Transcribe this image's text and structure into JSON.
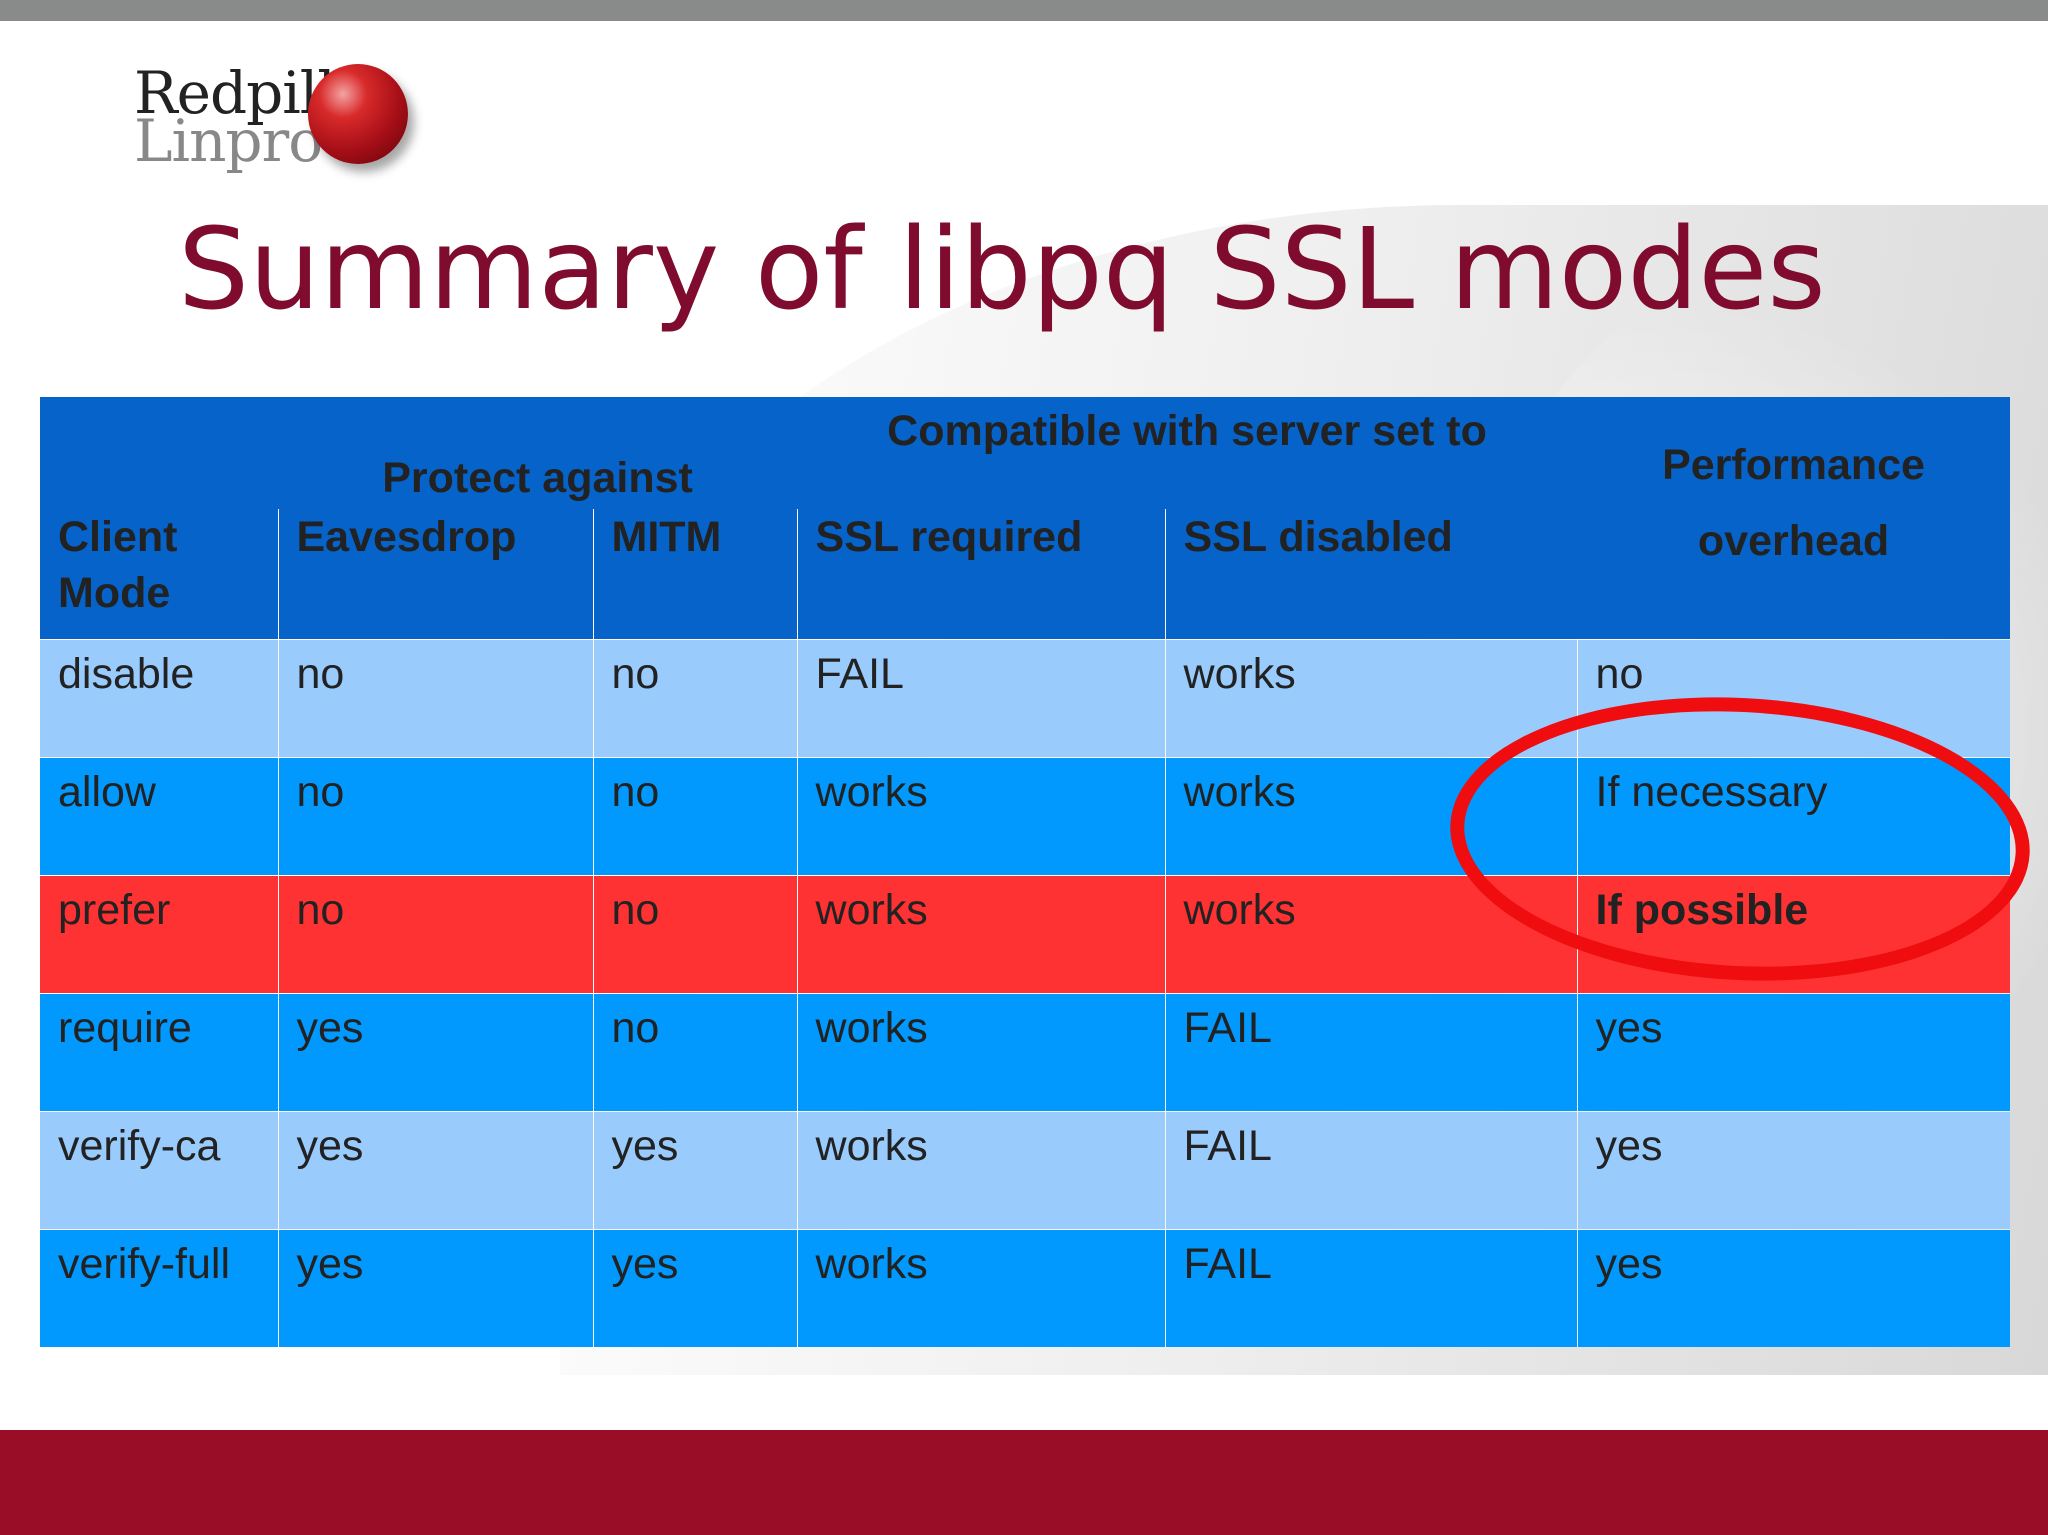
{
  "slide": {
    "title": "Summary of libpq SSL modes",
    "logo": {
      "line1": "Redpill",
      "line2": "Linpro",
      "colors": {
        "ball": "#c8101e",
        "line1": "#222222",
        "line2": "#888888"
      }
    }
  },
  "table": {
    "group_headers": {
      "protect": "Protect against",
      "compatible": "Compatible with server set to",
      "performance_line1": "Performance",
      "performance_line2": "overhead"
    },
    "columns": {
      "client_mode_line1": "Client",
      "client_mode_line2": "Mode",
      "eavesdrop": "Eavesdrop",
      "mitm": "MITM",
      "ssl_required": "SSL required",
      "ssl_disabled": "SSL disabled"
    },
    "rows": [
      {
        "mode": "disable",
        "eavesdrop": "no",
        "mitm": "no",
        "ssl_required": "FAIL",
        "ssl_disabled": "works",
        "overhead": "no"
      },
      {
        "mode": "allow",
        "eavesdrop": "no",
        "mitm": "no",
        "ssl_required": "works",
        "ssl_disabled": "works",
        "overhead": "If necessary"
      },
      {
        "mode": "prefer",
        "eavesdrop": "no",
        "mitm": "no",
        "ssl_required": "works",
        "ssl_disabled": "works",
        "overhead": "If possible"
      },
      {
        "mode": "require",
        "eavesdrop": "yes",
        "mitm": "no",
        "ssl_required": "works",
        "ssl_disabled": "FAIL",
        "overhead": "yes"
      },
      {
        "mode": "verify-ca",
        "eavesdrop": "yes",
        "mitm": "yes",
        "ssl_required": "works",
        "ssl_disabled": "FAIL",
        "overhead": "yes"
      },
      {
        "mode": "verify-full",
        "eavesdrop": "yes",
        "mitm": "yes",
        "ssl_required": "works",
        "ssl_disabled": "FAIL",
        "overhead": "yes"
      }
    ],
    "colors": {
      "header": "#0563c9",
      "row_light": "#99cbfd",
      "row_mid": "#0199fe",
      "row_highlight": "#fe3232",
      "annotation": "#f00d10"
    }
  }
}
